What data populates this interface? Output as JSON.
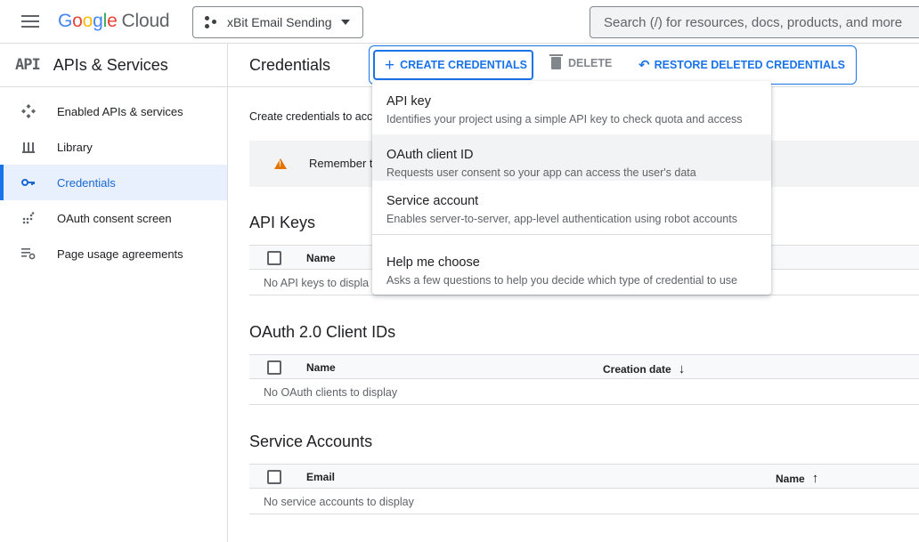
{
  "topbar": {
    "logo_letters": [
      "G",
      "o",
      "o",
      "g",
      "l",
      "e"
    ],
    "logo_suffix": "Cloud",
    "project_name": "xBit Email Sending",
    "search_placeholder": "Search (/) for resources, docs, products, and more"
  },
  "sidebar": {
    "logo_text": "API",
    "title": "APIs & Services",
    "items": [
      {
        "label": "Enabled APIs & services",
        "icon": "apis-icon"
      },
      {
        "label": "Library",
        "icon": "library-icon"
      },
      {
        "label": "Credentials",
        "icon": "key-icon",
        "active": true
      },
      {
        "label": "OAuth consent screen",
        "icon": "consent-icon"
      },
      {
        "label": "Page usage agreements",
        "icon": "settings-list-icon"
      }
    ]
  },
  "main": {
    "page_title": "Credentials",
    "actions": {
      "create": "CREATE CREDENTIALS",
      "delete": "DELETE",
      "restore": "RESTORE DELETED CREDENTIALS"
    },
    "intro": "Create credentials to acc",
    "banner_text": "Remember t",
    "sections": {
      "api_keys": {
        "title": "API Keys",
        "columns": [
          "Name"
        ],
        "empty": "No API keys to displa"
      },
      "oauth": {
        "title": "OAuth 2.0 Client IDs",
        "columns": [
          "Name",
          "Creation date"
        ],
        "empty": "No OAuth clients to display"
      },
      "service_accounts": {
        "title": "Service Accounts",
        "columns": [
          "Email",
          "Name"
        ],
        "empty": "No service accounts to display"
      }
    }
  },
  "menu": {
    "items": [
      {
        "title": "API key",
        "desc": "Identifies your project using a simple API key to check quota and access"
      },
      {
        "title": "OAuth client ID",
        "desc": "Requests user consent so your app can access the user's data"
      },
      {
        "title": "Service account",
        "desc": "Enables server-to-server, app-level authentication using robot accounts"
      },
      {
        "title": "Help me choose",
        "desc": "Asks a few questions to help you decide which type of credential to use"
      }
    ]
  },
  "colors": {
    "accent": "#1a73e8",
    "active_bg": "#e8f0fe",
    "warning": "#e37400"
  }
}
